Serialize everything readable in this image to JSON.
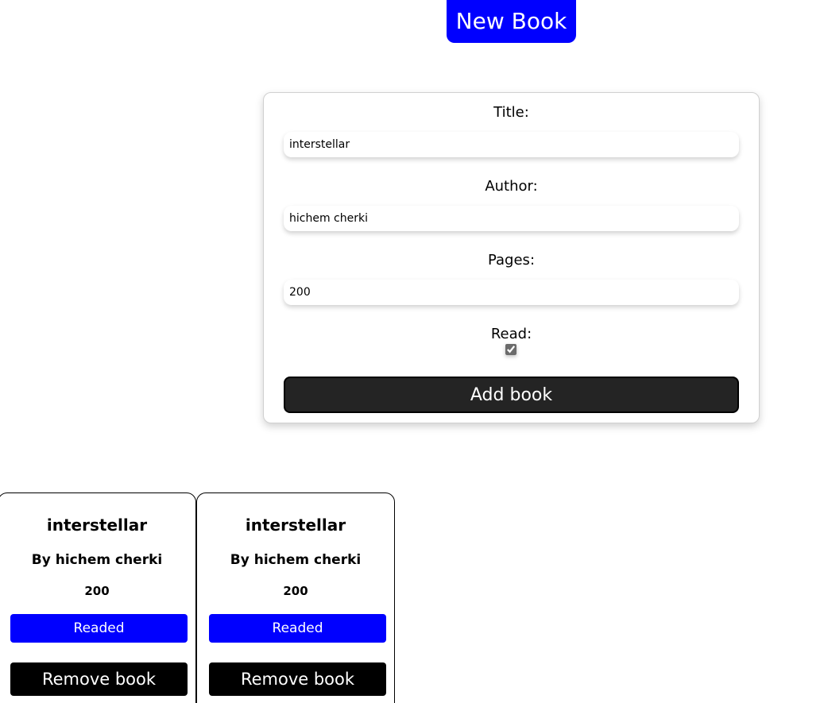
{
  "header": {
    "new_book_label": "New Book"
  },
  "form": {
    "title_label": "Title:",
    "title_value": "interstellar",
    "author_label": "Author:",
    "author_value": "hichem cherki",
    "pages_label": "Pages:",
    "pages_value": "200",
    "read_label": "Read:",
    "read_checked": true,
    "submit_label": "Add book"
  },
  "books": [
    {
      "title": "interstellar",
      "author": "By hichem cherki",
      "pages": "200",
      "status_label": "Readed",
      "remove_label": "Remove book"
    },
    {
      "title": "interstellar",
      "author": "By hichem cherki",
      "pages": "200",
      "status_label": "Readed",
      "remove_label": "Remove book"
    }
  ],
  "colors": {
    "accent": "#0000ff",
    "submit": "#242424",
    "remove": "#000000"
  }
}
